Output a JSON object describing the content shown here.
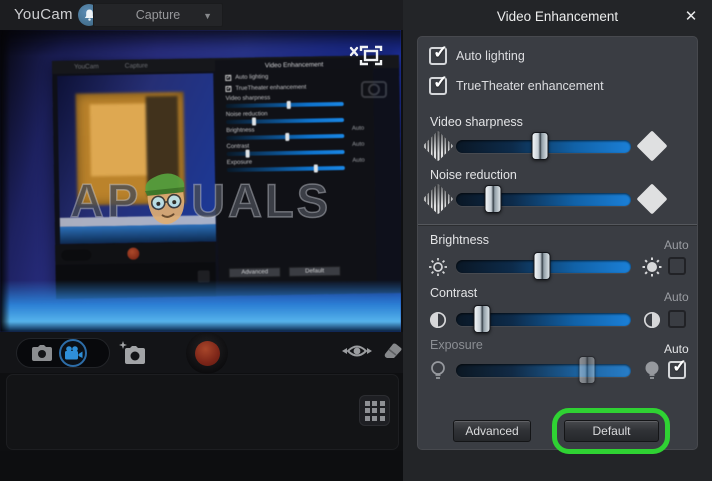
{
  "icons": {
    "check": "✓",
    "caret_down": "▼",
    "close": "✕"
  },
  "topbar": {
    "app_title": "YouCam",
    "capture_button": "Capture"
  },
  "video_overlay": {
    "watermark_left": "AP",
    "watermark_right": "UALS",
    "watermark_name": "APPUALS"
  },
  "panel": {
    "title": "Video Enhancement",
    "auto_lighting": {
      "label": "Auto lighting",
      "checked": true
    },
    "truetheater": {
      "label": "TrueTheater enhancement",
      "checked": true
    },
    "sliders": {
      "sharpness": {
        "label": "Video sharpness",
        "value_pct": 48
      },
      "noise": {
        "label": "Noise reduction",
        "value_pct": 21
      },
      "brightness": {
        "label": "Brightness",
        "auto_label": "Auto",
        "auto_checked": false,
        "value_pct": 49
      },
      "contrast": {
        "label": "Contrast",
        "auto_label": "Auto",
        "auto_checked": false,
        "value_pct": 15
      },
      "exposure": {
        "label": "Exposure",
        "auto_label": "Auto",
        "auto_checked": true,
        "disabled": true,
        "value_pct": 75
      }
    },
    "buttons": {
      "advanced": "Advanced",
      "default": "Default"
    },
    "annotation_color": "#2fd233"
  },
  "colors": {
    "accent_blue": "#1e86e0",
    "panel_bg": "#3a3d43",
    "record_red": "#8a2d1d",
    "annotation_green": "#2fd233"
  }
}
